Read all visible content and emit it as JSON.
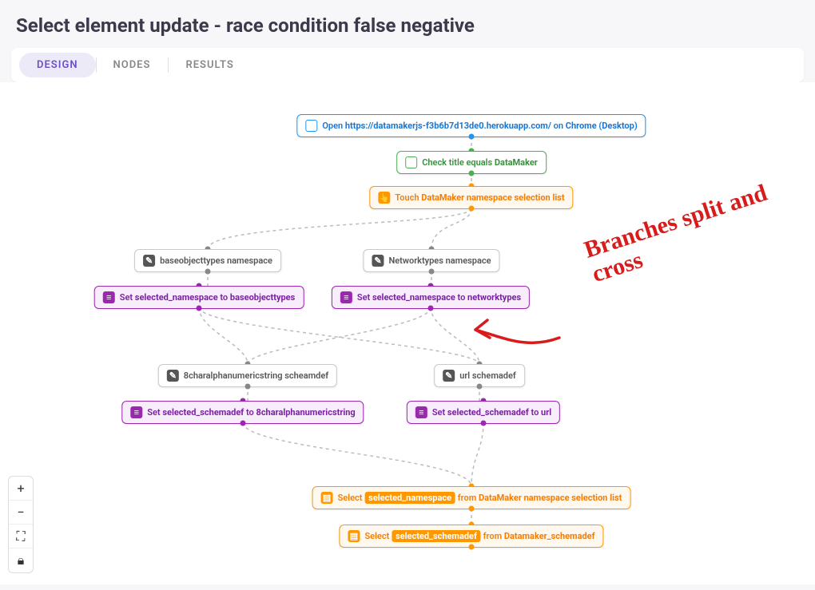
{
  "title": "Select element update - race condition false negative",
  "tabs": {
    "design": "DESIGN",
    "nodes": "NODES",
    "results": "RESULTS"
  },
  "annotation": "Branches split and cross",
  "controls": {
    "zoomin": "+",
    "zoomout": "−",
    "fullscreen": "⛶",
    "lock": "🔒︎"
  },
  "nodes": {
    "open": {
      "prefix": "Open",
      "url": "https://datamakerjs-f3b6b7d13de0.herokuapp.com/",
      "mid": "on",
      "target": "Chrome (Desktop)"
    },
    "check": {
      "prefix": "Check title equals",
      "value": "DataMaker"
    },
    "touch": {
      "prefix": "Touch",
      "target": "DataMaker namespace selection list"
    },
    "ns_left": "baseobjecttypes namespace",
    "ns_right": "Networktypes namespace",
    "set_ns_left": {
      "p1": "Set",
      "v1": "selected_namespace",
      "p2": "to",
      "v2": "baseobjecttypes"
    },
    "set_ns_right": {
      "p1": "Set",
      "v1": "selected_namespace",
      "p2": "to",
      "v2": "networktypes"
    },
    "sd_left": "8charalphanumericstring scheamdef",
    "sd_right": "url schemadef",
    "set_sd_left": {
      "p1": "Set",
      "v1": "selected_schemadef",
      "p2": "to",
      "v2": "8charalphanumericstring"
    },
    "set_sd_right": {
      "p1": "Set",
      "v1": "selected_schemadef",
      "p2": "to",
      "v2": "url"
    },
    "select1": {
      "p1": "Select",
      "v": "selected_namespace",
      "p2": "from",
      "t": "DataMaker namespace selection list"
    },
    "select2": {
      "p1": "Select",
      "v": "selected_schemadef",
      "p2": "from",
      "t": "Datamaker_schemadef"
    }
  }
}
